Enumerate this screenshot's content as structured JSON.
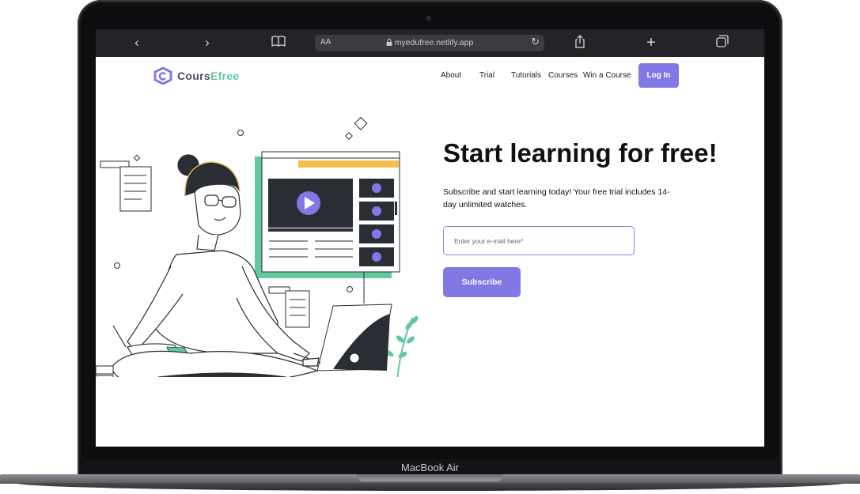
{
  "browser": {
    "url_aa": "AA",
    "url": "myedufree.netlify.app",
    "back_icon": "chevron-left-icon",
    "forward_icon": "chevron-right-icon",
    "reader_icon": "book-icon",
    "share_icon": "share-icon",
    "new_tab_icon": "plus-icon",
    "tabs_icon": "tabs-icon"
  },
  "site": {
    "logo_part1": "Cours",
    "logo_part2": "Efree",
    "brand_color": "#8178e6",
    "accent_color": "#62c99f",
    "nav": [
      "About",
      "Trial",
      "Tutorials",
      "Courses",
      "Win a Course"
    ],
    "login_label": "Log In",
    "headline": "Start learning for free!",
    "subtext": "Subscribe and start learning today! Your free trial includes 14-day unlimited watches.",
    "email_placeholder": "Enter your e-mail here*",
    "subscribe_label": "Subscribe"
  },
  "device": {
    "model_label": "MacBook Air"
  }
}
